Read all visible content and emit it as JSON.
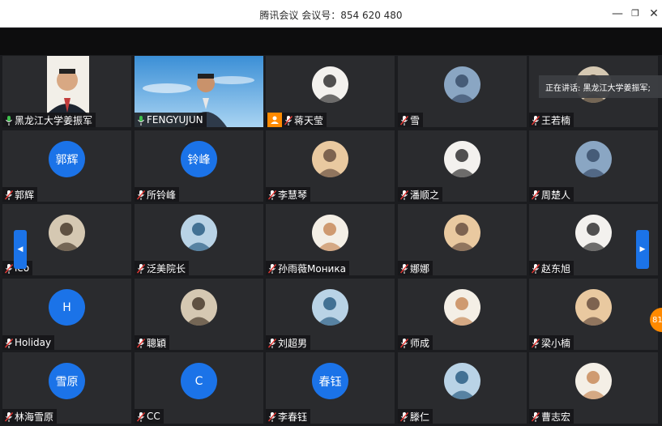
{
  "window": {
    "title": "腾讯会议 会议号：854 620 480",
    "minimize_glyph": "—",
    "maximize_glyph": "❐",
    "close_glyph": "✕"
  },
  "speaking_indicator": "正在讲话: 黑龙江大学姜振军;",
  "nav": {
    "prev_glyph": "◀",
    "next_glyph": "▶"
  },
  "floating_badge": "81",
  "colors": {
    "avatar_blue": "#1b73e8",
    "host_orange": "#ff8a00",
    "active_green": "#33b44a"
  },
  "participants": [
    {
      "name": "黑龙江大学姜振军",
      "kind": "video",
      "mic": "on",
      "active": true
    },
    {
      "name": "FENGYUJUN",
      "kind": "video",
      "mic": "on"
    },
    {
      "name": "蒋天莹",
      "kind": "photo",
      "mic": "muted",
      "host": true
    },
    {
      "name": "雪",
      "kind": "photo",
      "mic": "muted"
    },
    {
      "name": "王若楠",
      "kind": "photo",
      "mic": "muted"
    },
    {
      "name": "郭辉",
      "kind": "text",
      "avatar_text": "郭辉",
      "mic": "muted"
    },
    {
      "name": "所铃峰",
      "kind": "text",
      "avatar_text": "铃峰",
      "mic": "muted"
    },
    {
      "name": "李慧琴",
      "kind": "photo",
      "mic": "muted"
    },
    {
      "name": "潘顺之",
      "kind": "photo",
      "mic": "muted"
    },
    {
      "name": "周楚人",
      "kind": "photo",
      "mic": "muted"
    },
    {
      "name": "leo",
      "kind": "photo",
      "mic": "muted"
    },
    {
      "name": "泛美院长",
      "kind": "photo",
      "mic": "muted"
    },
    {
      "name": "孙雨薇Моника",
      "kind": "photo",
      "mic": "muted"
    },
    {
      "name": "娜娜",
      "kind": "photo",
      "mic": "muted"
    },
    {
      "name": "赵东旭",
      "kind": "photo",
      "mic": "muted"
    },
    {
      "name": "Holiday",
      "kind": "text",
      "avatar_text": "H",
      "mic": "muted"
    },
    {
      "name": "聰穎",
      "kind": "photo",
      "mic": "muted"
    },
    {
      "name": "刘超男",
      "kind": "photo",
      "mic": "muted"
    },
    {
      "name": "师成",
      "kind": "photo",
      "mic": "muted"
    },
    {
      "name": "梁小楠",
      "kind": "photo",
      "mic": "muted"
    },
    {
      "name": "林海雪原",
      "kind": "text",
      "avatar_text": "雪原",
      "mic": "muted"
    },
    {
      "name": "CC",
      "kind": "text",
      "avatar_text": "C",
      "mic": "muted"
    },
    {
      "name": "李春钰",
      "kind": "text",
      "avatar_text": "春钰",
      "mic": "muted"
    },
    {
      "name": "滕仁",
      "kind": "photo",
      "mic": "muted"
    },
    {
      "name": "曹志宏",
      "kind": "photo",
      "mic": "muted"
    }
  ]
}
